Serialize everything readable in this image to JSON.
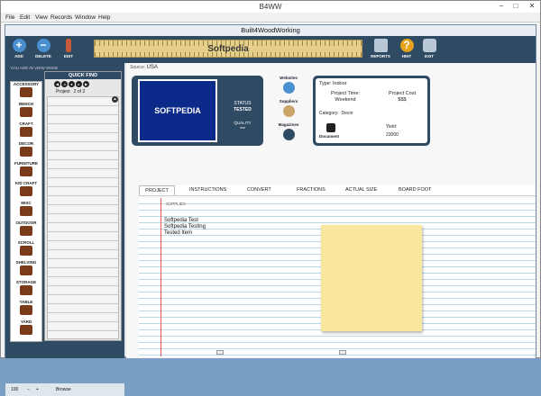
{
  "app": {
    "title": "B4WW",
    "inner_title": "Built4WoodWorking"
  },
  "menu": [
    "File",
    "Edit",
    "View",
    "Records",
    "Window",
    "Help"
  ],
  "window_controls": {
    "minimize": "–",
    "maximize": "□",
    "close": "✕"
  },
  "toolbar": {
    "add": "ADD",
    "delete": "DELETE",
    "edit": "EDIT",
    "reports": "REPORTS",
    "hint": "HINT",
    "exit": "EXIT",
    "brand": "Softpedia"
  },
  "left": {
    "view_mode": "YOU ARE IN VIEW MODE",
    "quick_find": "QUICK FIND",
    "project_label": "Project",
    "project_num": "2",
    "project_of": "of",
    "project_total": "2",
    "categories": [
      "ACCESSORY",
      "BENCH",
      "CRAFT",
      "DECOR",
      "FURNITURE",
      "KID CRAFT",
      "MISC",
      "OUTDOOR",
      "SCROLL",
      "SHELVING",
      "STORAGE",
      "TABLE",
      "YARD"
    ]
  },
  "statusbar": {
    "zoom": "100",
    "mode": "Browse"
  },
  "main": {
    "source_label": "Source:",
    "source_value": "USA",
    "image_text": "SOFTPEDIA",
    "status_label": "STATUS",
    "status_value": "TESTED",
    "quality_label": "QUALITY",
    "quality_value": "***",
    "links": [
      "Websites",
      "Suppliers",
      "Magazines"
    ],
    "info": {
      "type_label": "Type:",
      "type_value": "Indoor",
      "time_label": "Project Time:",
      "time_value": "Weekend",
      "cost_label": "Project Cost",
      "cost_value": "$$$",
      "category_label": "Category:",
      "category_value": "Decor",
      "document_label": "Document",
      "yield_label": "Yield:",
      "yield_value": "23000"
    },
    "tabs": [
      "PROJECT",
      "INSTRUCTIONS",
      "CONVERT",
      "FRACTIONS",
      "ACTUAL SIZE",
      "BOARD FOOT"
    ],
    "supplies_label": "SUPPLIES",
    "items": [
      "Softpedia Test",
      "Softpedia Testing",
      "Tested Item"
    ]
  }
}
